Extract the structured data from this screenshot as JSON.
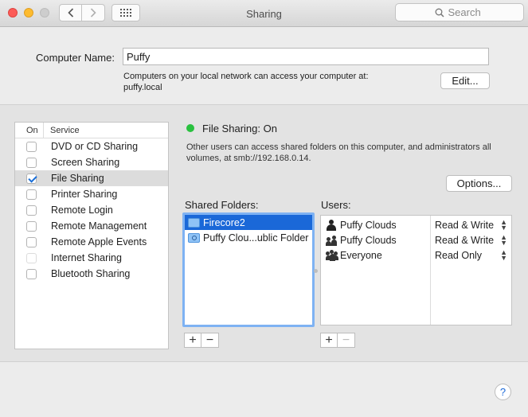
{
  "window": {
    "title": "Sharing"
  },
  "search": {
    "placeholder": "Search"
  },
  "computer": {
    "label": "Computer Name:",
    "name": "Puffy",
    "description": "Computers on your local network can access your computer at:",
    "address": "puffy.local",
    "edit_label": "Edit..."
  },
  "services": {
    "col_on": "On",
    "col_service": "Service",
    "items": [
      {
        "label": "DVD or CD Sharing",
        "checked": false,
        "disabled": false,
        "selected": false
      },
      {
        "label": "Screen Sharing",
        "checked": false,
        "disabled": false,
        "selected": false
      },
      {
        "label": "File Sharing",
        "checked": true,
        "disabled": false,
        "selected": true
      },
      {
        "label": "Printer Sharing",
        "checked": false,
        "disabled": false,
        "selected": false
      },
      {
        "label": "Remote Login",
        "checked": false,
        "disabled": false,
        "selected": false
      },
      {
        "label": "Remote Management",
        "checked": false,
        "disabled": false,
        "selected": false
      },
      {
        "label": "Remote Apple Events",
        "checked": false,
        "disabled": false,
        "selected": false
      },
      {
        "label": "Internet Sharing",
        "checked": false,
        "disabled": true,
        "selected": false
      },
      {
        "label": "Bluetooth Sharing",
        "checked": false,
        "disabled": false,
        "selected": false
      }
    ]
  },
  "status": {
    "text": "File Sharing: On",
    "color": "#29c13f",
    "description": "Other users can access shared folders on this computer, and administrators all volumes, at smb://192.168.0.14."
  },
  "options_label": "Options...",
  "shared_folders": {
    "label": "Shared Folders:",
    "items": [
      {
        "name": "Firecore2",
        "selected": true,
        "icon": "folder-icon"
      },
      {
        "name": "Puffy Clou...ublic Folder",
        "selected": false,
        "icon": "shared-folder-icon"
      }
    ]
  },
  "users": {
    "label": "Users:",
    "items": [
      {
        "name": "Puffy Clouds",
        "permission": "Read & Write",
        "icon": "user-icon"
      },
      {
        "name": "Puffy Clouds",
        "permission": "Read & Write",
        "icon": "group-icon"
      },
      {
        "name": "Everyone",
        "permission": "Read Only",
        "icon": "everyone-icon"
      }
    ]
  },
  "buttons": {
    "add": "+",
    "remove": "−",
    "help": "?"
  },
  "colors": {
    "selection": "#1a68d8",
    "focus_ring": "#7eb2f3",
    "close": "#fc5b57",
    "minimize": "#fdbb2e"
  }
}
